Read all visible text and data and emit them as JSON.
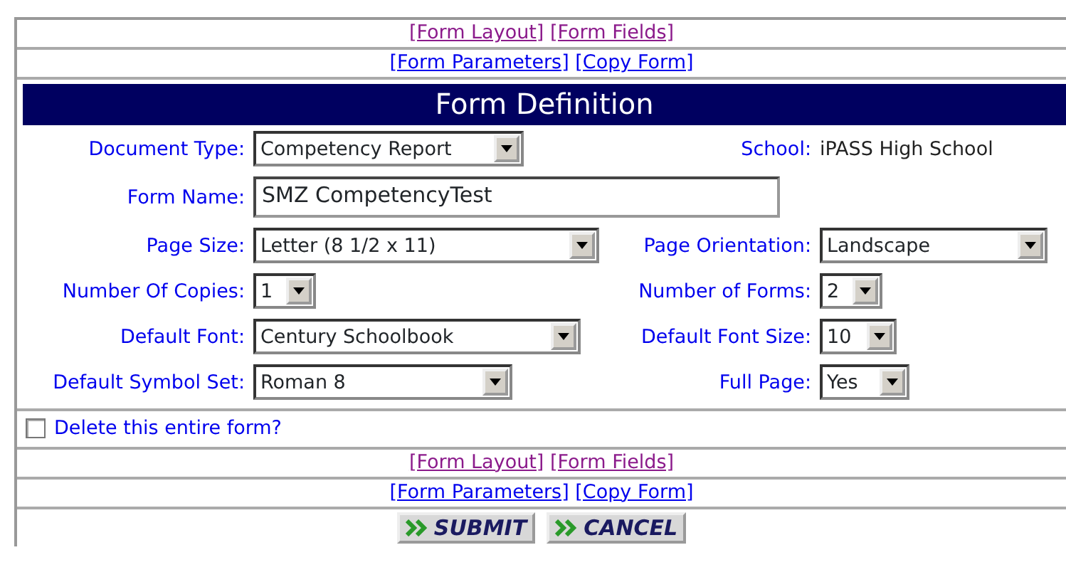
{
  "top_links": [
    [
      {
        "label": "[Form Layout]",
        "visited": true
      },
      {
        "label": "[Form Fields]",
        "visited": true
      }
    ],
    [
      {
        "label": "[Form Parameters]",
        "visited": false
      },
      {
        "label": "[Copy Form]",
        "visited": false
      }
    ]
  ],
  "header": {
    "title": "Form Definition"
  },
  "rows": [
    [
      {
        "label": "Document Type:",
        "kind": "select",
        "value": "Competency Report"
      },
      {
        "label": "School:",
        "kind": "text",
        "value": "iPASS High School"
      }
    ],
    [
      {
        "label": "Form Name:",
        "kind": "input",
        "value": "SMZ CompetencyTest"
      }
    ],
    [
      {
        "label": "Page Size:",
        "kind": "select",
        "value": "Letter (8 1/2 x 11)"
      },
      {
        "label": "Page Orientation:",
        "kind": "select",
        "value": "Landscape"
      }
    ],
    [
      {
        "label": "Number Of Copies:",
        "kind": "select",
        "value": "1"
      },
      {
        "label": "Number of Forms:",
        "kind": "select",
        "value": "2"
      }
    ],
    [
      {
        "label": "Default Font:",
        "kind": "select",
        "value": "Century Schoolbook"
      },
      {
        "label": "Default Font Size:",
        "kind": "select",
        "value": "10"
      }
    ],
    [
      {
        "label": "Default Symbol Set:",
        "kind": "select",
        "value": "Roman 8"
      },
      {
        "label": "Full Page:",
        "kind": "select",
        "value": "Yes"
      }
    ]
  ],
  "delete": {
    "label": "Delete this entire form?",
    "checked": false
  },
  "bottom_links": [
    [
      {
        "label": "[Form Layout]",
        "visited": true
      },
      {
        "label": "[Form Fields]",
        "visited": true
      }
    ],
    [
      {
        "label": "[Form Parameters]",
        "visited": false
      },
      {
        "label": "[Copy Form]",
        "visited": false
      }
    ]
  ],
  "buttons": [
    {
      "label": "SUBMIT"
    },
    {
      "label": "CANCEL"
    }
  ]
}
